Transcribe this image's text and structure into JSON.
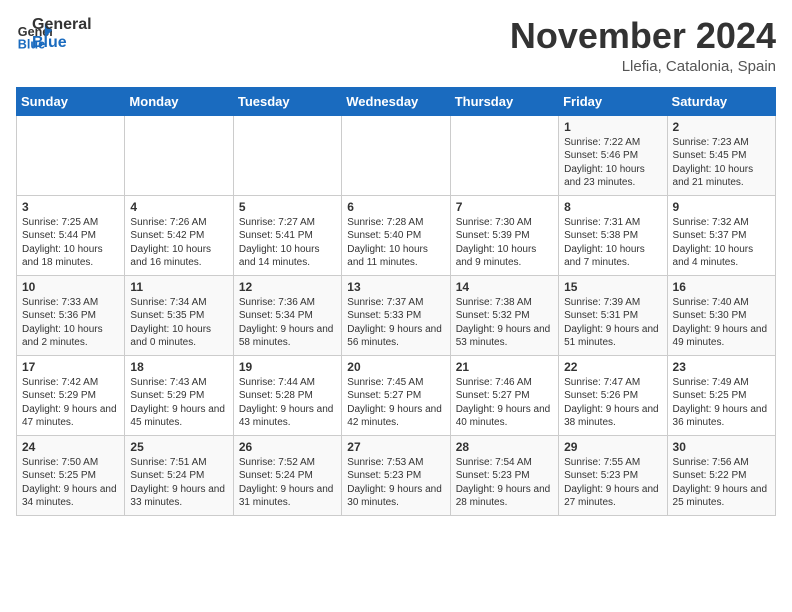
{
  "header": {
    "logo_general": "General",
    "logo_blue": "Blue",
    "month_title": "November 2024",
    "location": "Llefia, Catalonia, Spain"
  },
  "days_of_week": [
    "Sunday",
    "Monday",
    "Tuesday",
    "Wednesday",
    "Thursday",
    "Friday",
    "Saturday"
  ],
  "weeks": [
    [
      {
        "day": "",
        "info": ""
      },
      {
        "day": "",
        "info": ""
      },
      {
        "day": "",
        "info": ""
      },
      {
        "day": "",
        "info": ""
      },
      {
        "day": "",
        "info": ""
      },
      {
        "day": "1",
        "info": "Sunrise: 7:22 AM\nSunset: 5:46 PM\nDaylight: 10 hours and 23 minutes."
      },
      {
        "day": "2",
        "info": "Sunrise: 7:23 AM\nSunset: 5:45 PM\nDaylight: 10 hours and 21 minutes."
      }
    ],
    [
      {
        "day": "3",
        "info": "Sunrise: 7:25 AM\nSunset: 5:44 PM\nDaylight: 10 hours and 18 minutes."
      },
      {
        "day": "4",
        "info": "Sunrise: 7:26 AM\nSunset: 5:42 PM\nDaylight: 10 hours and 16 minutes."
      },
      {
        "day": "5",
        "info": "Sunrise: 7:27 AM\nSunset: 5:41 PM\nDaylight: 10 hours and 14 minutes."
      },
      {
        "day": "6",
        "info": "Sunrise: 7:28 AM\nSunset: 5:40 PM\nDaylight: 10 hours and 11 minutes."
      },
      {
        "day": "7",
        "info": "Sunrise: 7:30 AM\nSunset: 5:39 PM\nDaylight: 10 hours and 9 minutes."
      },
      {
        "day": "8",
        "info": "Sunrise: 7:31 AM\nSunset: 5:38 PM\nDaylight: 10 hours and 7 minutes."
      },
      {
        "day": "9",
        "info": "Sunrise: 7:32 AM\nSunset: 5:37 PM\nDaylight: 10 hours and 4 minutes."
      }
    ],
    [
      {
        "day": "10",
        "info": "Sunrise: 7:33 AM\nSunset: 5:36 PM\nDaylight: 10 hours and 2 minutes."
      },
      {
        "day": "11",
        "info": "Sunrise: 7:34 AM\nSunset: 5:35 PM\nDaylight: 10 hours and 0 minutes."
      },
      {
        "day": "12",
        "info": "Sunrise: 7:36 AM\nSunset: 5:34 PM\nDaylight: 9 hours and 58 minutes."
      },
      {
        "day": "13",
        "info": "Sunrise: 7:37 AM\nSunset: 5:33 PM\nDaylight: 9 hours and 56 minutes."
      },
      {
        "day": "14",
        "info": "Sunrise: 7:38 AM\nSunset: 5:32 PM\nDaylight: 9 hours and 53 minutes."
      },
      {
        "day": "15",
        "info": "Sunrise: 7:39 AM\nSunset: 5:31 PM\nDaylight: 9 hours and 51 minutes."
      },
      {
        "day": "16",
        "info": "Sunrise: 7:40 AM\nSunset: 5:30 PM\nDaylight: 9 hours and 49 minutes."
      }
    ],
    [
      {
        "day": "17",
        "info": "Sunrise: 7:42 AM\nSunset: 5:29 PM\nDaylight: 9 hours and 47 minutes."
      },
      {
        "day": "18",
        "info": "Sunrise: 7:43 AM\nSunset: 5:29 PM\nDaylight: 9 hours and 45 minutes."
      },
      {
        "day": "19",
        "info": "Sunrise: 7:44 AM\nSunset: 5:28 PM\nDaylight: 9 hours and 43 minutes."
      },
      {
        "day": "20",
        "info": "Sunrise: 7:45 AM\nSunset: 5:27 PM\nDaylight: 9 hours and 42 minutes."
      },
      {
        "day": "21",
        "info": "Sunrise: 7:46 AM\nSunset: 5:27 PM\nDaylight: 9 hours and 40 minutes."
      },
      {
        "day": "22",
        "info": "Sunrise: 7:47 AM\nSunset: 5:26 PM\nDaylight: 9 hours and 38 minutes."
      },
      {
        "day": "23",
        "info": "Sunrise: 7:49 AM\nSunset: 5:25 PM\nDaylight: 9 hours and 36 minutes."
      }
    ],
    [
      {
        "day": "24",
        "info": "Sunrise: 7:50 AM\nSunset: 5:25 PM\nDaylight: 9 hours and 34 minutes."
      },
      {
        "day": "25",
        "info": "Sunrise: 7:51 AM\nSunset: 5:24 PM\nDaylight: 9 hours and 33 minutes."
      },
      {
        "day": "26",
        "info": "Sunrise: 7:52 AM\nSunset: 5:24 PM\nDaylight: 9 hours and 31 minutes."
      },
      {
        "day": "27",
        "info": "Sunrise: 7:53 AM\nSunset: 5:23 PM\nDaylight: 9 hours and 30 minutes."
      },
      {
        "day": "28",
        "info": "Sunrise: 7:54 AM\nSunset: 5:23 PM\nDaylight: 9 hours and 28 minutes."
      },
      {
        "day": "29",
        "info": "Sunrise: 7:55 AM\nSunset: 5:23 PM\nDaylight: 9 hours and 27 minutes."
      },
      {
        "day": "30",
        "info": "Sunrise: 7:56 AM\nSunset: 5:22 PM\nDaylight: 9 hours and 25 minutes."
      }
    ]
  ]
}
